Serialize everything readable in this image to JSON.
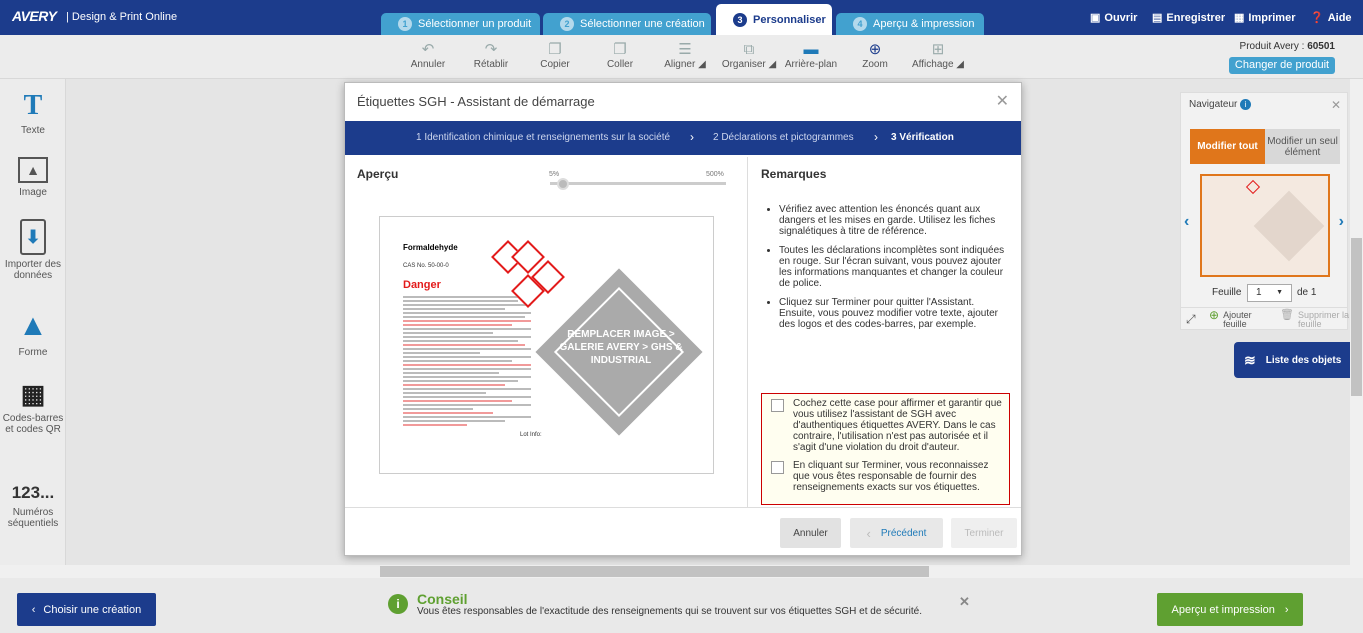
{
  "app": {
    "logo": "AVERY",
    "subtitle": "Design & Print Online"
  },
  "steps": [
    {
      "num": "1",
      "label": "Sélectionner un produit"
    },
    {
      "num": "2",
      "label": "Sélectionner une création"
    },
    {
      "num": "3",
      "label": "Personnaliser"
    },
    {
      "num": "4",
      "label": "Aperçu & impression"
    }
  ],
  "top_actions": {
    "open": "Ouvrir",
    "save": "Enregistrer",
    "print": "Imprimer",
    "help": "Aide"
  },
  "toolbar": {
    "undo": "Annuler",
    "redo": "Rétablir",
    "copy": "Copier",
    "paste": "Coller",
    "align": "Aligner",
    "arrange": "Organiser",
    "background": "Arrière-plan",
    "zoom": "Zoom",
    "display": "Affichage"
  },
  "product": {
    "label": "Produit Avery :",
    "code": "60501",
    "change": "Changer de produit"
  },
  "left_tools": {
    "text": "Texte",
    "image": "Image",
    "import": "Importer des données",
    "shape": "Forme",
    "barcodes": "Codes-barres et codes QR",
    "sequential_icon": "123...",
    "sequential": "Numéros séquentiels"
  },
  "navigator": {
    "title": "Navigateur",
    "edit_all": "Modifier tout",
    "edit_one": "Modifier un seul élément",
    "sheet_label": "Feuille",
    "sheet_value": "1",
    "sheet_of": "de 1",
    "add_sheet": "Ajouter feuille",
    "delete_sheet": "Supprimer la feuille"
  },
  "objects_button": "Liste des objets",
  "bottom": {
    "choose": "Choisir une création",
    "next": "Aperçu et impression",
    "tip_title": "Conseil",
    "tip_body": "Vous êtes responsables de l'exactitude des renseignements qui se trouvent sur vos étiquettes SGH et de sécurité."
  },
  "modal": {
    "title": "Étiquettes SGH - Assistant de démarrage",
    "steps": [
      "1 Identification chimique et renseignements sur la société",
      "2 Déclarations et pictogrammes",
      "3 Vérification"
    ],
    "preview_heading": "Aperçu",
    "zoom_min": "5%",
    "zoom_max": "500%",
    "zoom_level": 0.05,
    "label_preview": {
      "name": "Formaldehyde",
      "cas": "CAS No. 50-00-0",
      "signal": "Danger",
      "lot": "Lot Info:",
      "placeholder": "REMPLACER IMAGE > GALERIE AVERY > GHS & INDUSTRIAL"
    },
    "remarks_heading": "Remarques",
    "remarks": [
      "Vérifiez avec attention les énoncés quant aux dangers et les mises en garde. Utilisez les fiches signalétiques à titre de référence.",
      "Toutes les déclarations incomplètes sont indiquées en rouge. Sur l'écran suivant, vous pouvez ajouter les informations manquantes et changer la couleur de police.",
      "Cliquez sur Terminer pour quitter l'Assistant. Ensuite, vous pouvez modifier votre texte, ajouter des logos et des codes-barres, par exemple."
    ],
    "confirm1": "Cochez cette case pour affirmer et garantir que vous utilisez l'assistant de SGH avec d'authentiques étiquettes AVERY. Dans le cas contraire, l'utilisation n'est pas autorisée et il s'agit d'une violation du droit d'auteur.",
    "confirm2": "En cliquant sur Terminer, vous reconnaissez que vous êtes responsable de fournir des renseignements exacts sur vos étiquettes.",
    "cancel": "Annuler",
    "previous": "Précédent",
    "finish": "Terminer"
  },
  "colors": {
    "brand_blue": "#1c3c8c",
    "tab_blue": "#42a1cf",
    "orange": "#e0761b",
    "green": "#5fa031",
    "danger_red": "#e31b1b"
  }
}
